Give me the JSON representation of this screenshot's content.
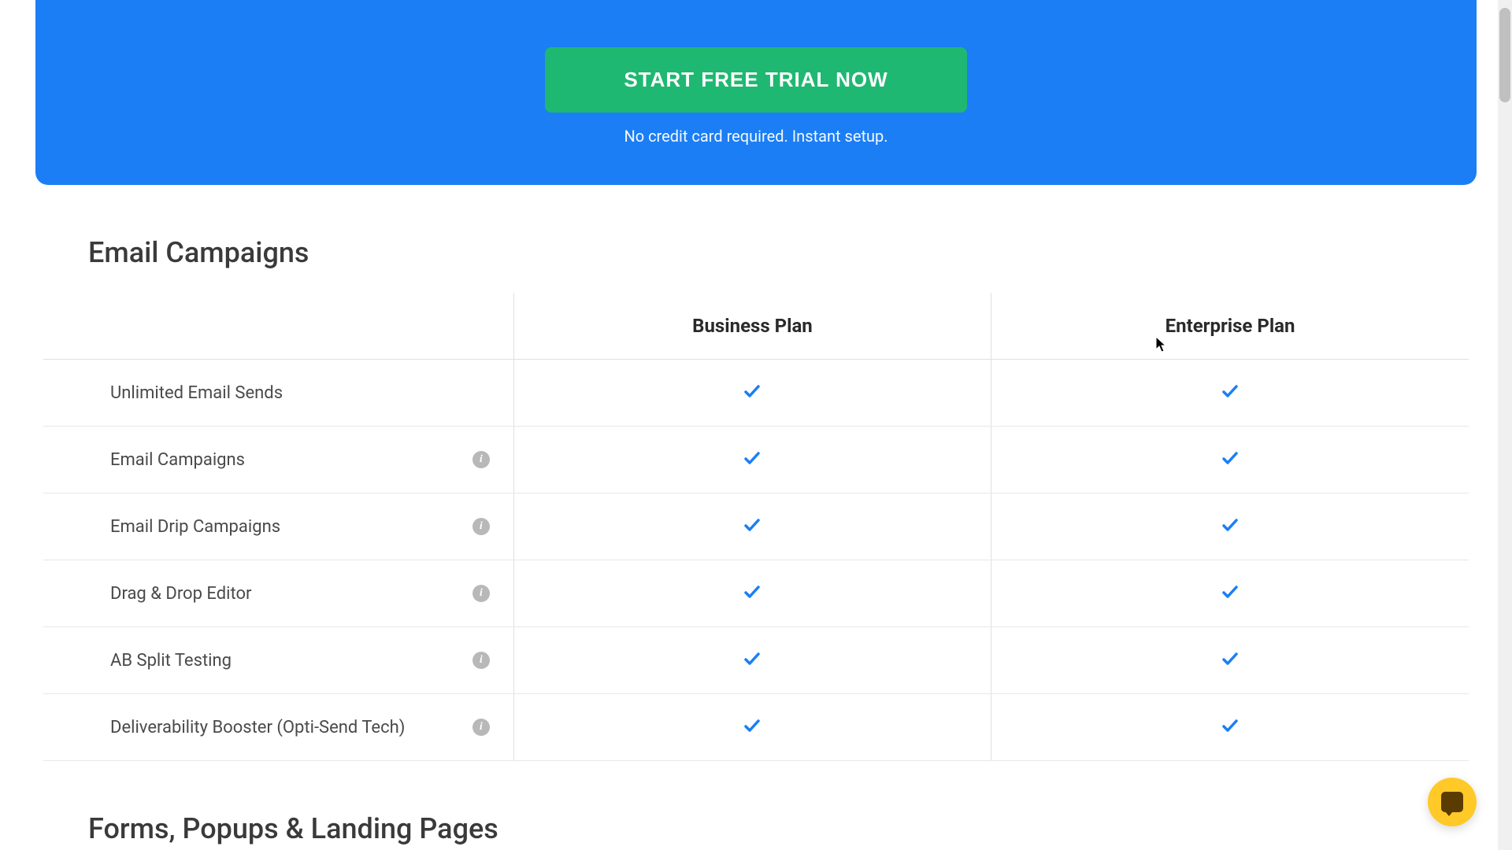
{
  "hero": {
    "cta_label": "START FREE TRIAL NOW",
    "cta_subtext": "No credit card required. Instant setup."
  },
  "sections": {
    "email_campaigns_title": "Email Campaigns",
    "forms_title": "Forms, Popups & Landing Pages"
  },
  "table": {
    "plan_columns": [
      "Business Plan",
      "Enterprise Plan"
    ],
    "rows": [
      {
        "label": "Unlimited Email Sends",
        "has_info": false,
        "business": true,
        "enterprise": true
      },
      {
        "label": "Email Campaigns",
        "has_info": true,
        "business": true,
        "enterprise": true
      },
      {
        "label": "Email Drip Campaigns",
        "has_info": true,
        "business": true,
        "enterprise": true
      },
      {
        "label": "Drag & Drop Editor",
        "has_info": true,
        "business": true,
        "enterprise": true
      },
      {
        "label": "AB Split Testing",
        "has_info": true,
        "business": true,
        "enterprise": true
      },
      {
        "label": "Deliverability Booster (Opti-Send Tech)",
        "has_info": true,
        "business": true,
        "enterprise": true
      }
    ]
  },
  "colors": {
    "banner_bg": "#1b7ef5",
    "cta_bg": "#1fb872",
    "check_color": "#1b7ef5",
    "chat_bg": "#ffc928"
  }
}
